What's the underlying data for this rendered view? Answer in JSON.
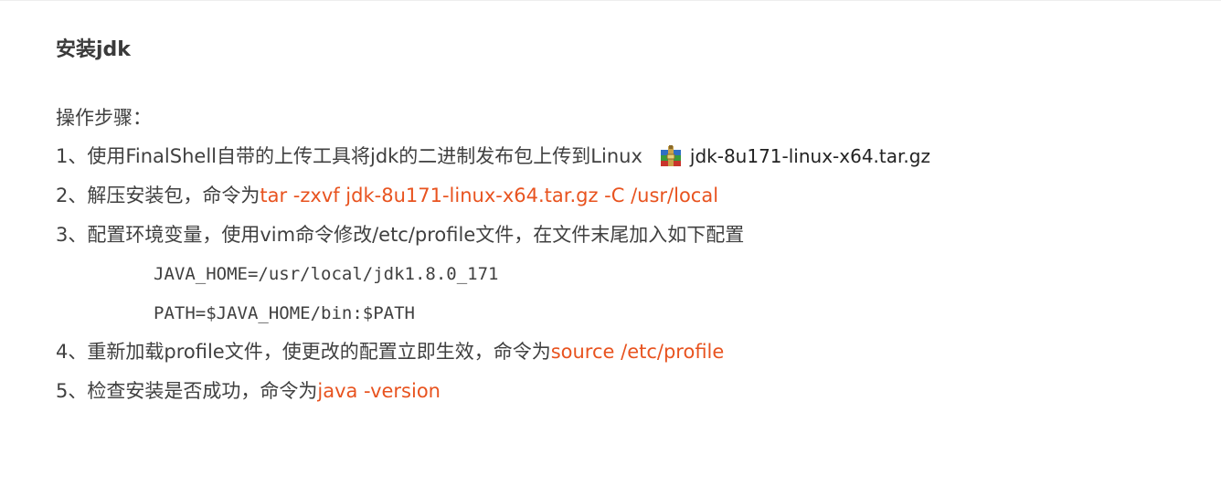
{
  "heading": "安装jdk",
  "intro": "操作步骤：",
  "steps": [
    {
      "text": "1、使用FinalShell自带的上传工具将jdk的二进制发布包上传到Linux",
      "file": "jdk-8u171-linux-x64.tar.gz",
      "file_icon": "archive-icon"
    },
    {
      "text": "2、解压安装包，命令为",
      "command": "tar -zxvf jdk-8u171-linux-x64.tar.gz -C /usr/local"
    },
    {
      "text": "3、配置环境变量，使用vim命令修改/etc/profile文件，在文件末尾加入如下配置"
    },
    {
      "text": "4、重新加载profile文件，使更改的配置立即生效，命令为",
      "command": "source /etc/profile"
    },
    {
      "text": "5、检查安装是否成功，命令为",
      "command": "java -version"
    }
  ],
  "config_lines": [
    "JAVA_HOME=/usr/local/jdk1.8.0_171",
    "PATH=$JAVA_HOME/bin:$PATH"
  ],
  "colors": {
    "command": "#e8531f",
    "text": "#404040"
  }
}
